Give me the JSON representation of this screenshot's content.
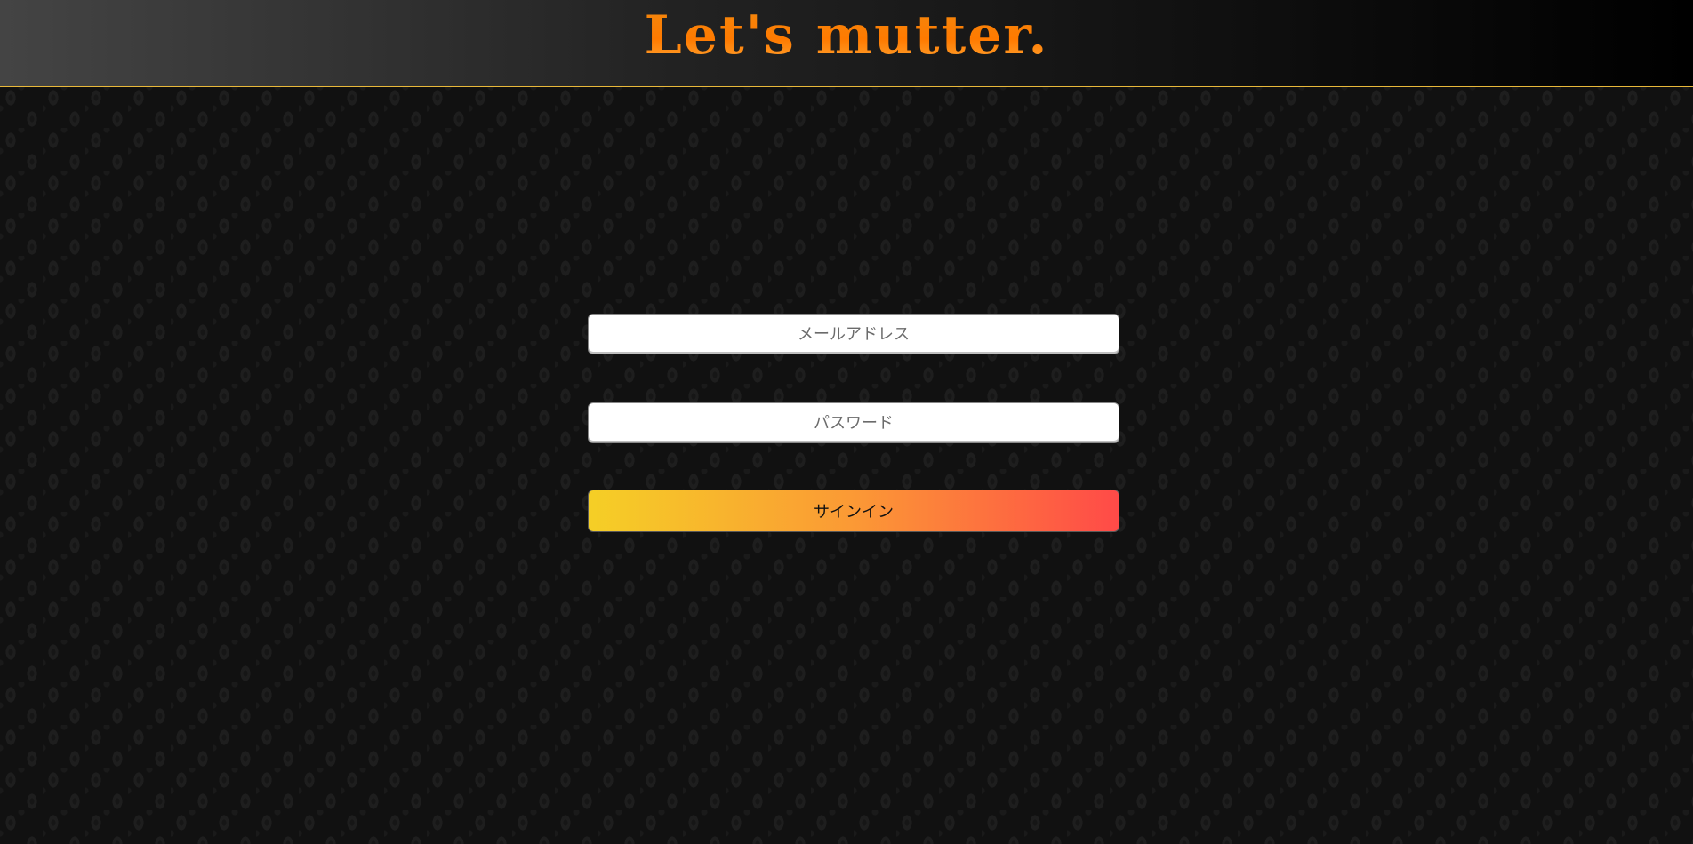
{
  "header": {
    "logo_text": "Let's mutter."
  },
  "signin_form": {
    "email": {
      "value": "",
      "placeholder": "メールアドレス"
    },
    "password": {
      "value": "",
      "placeholder": "パスワード"
    },
    "submit_label": "サインイン"
  },
  "colors": {
    "header_border": "#e8b83a",
    "logo": "#ff7a00",
    "button_gradient": [
      "#f5cf26",
      "#fb9935",
      "#ff4a48"
    ]
  }
}
